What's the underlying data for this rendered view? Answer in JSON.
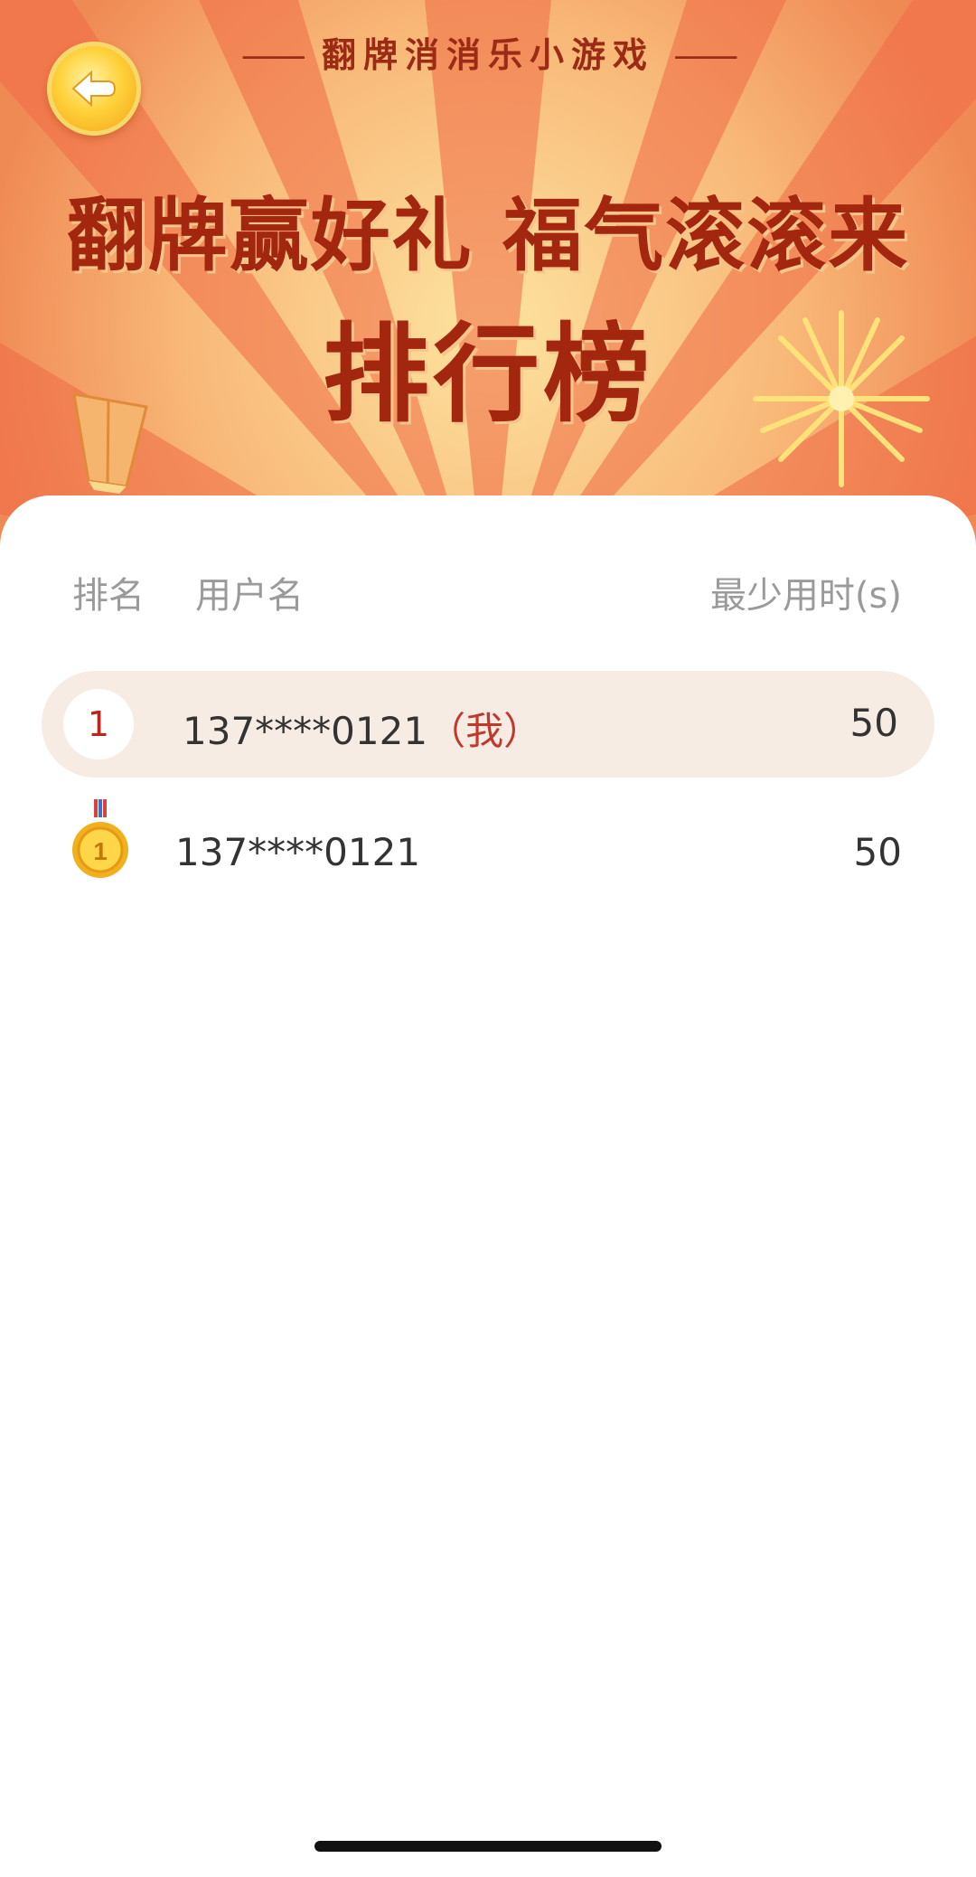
{
  "header": {
    "subtitle": "翻牌消消乐小游戏",
    "subtitle_dash": "——",
    "headline": "翻牌赢好礼 福气滚滚来",
    "board_title": "排行榜",
    "back_icon": "back-arrow-icon"
  },
  "table": {
    "columns": {
      "rank": "排名",
      "user": "用户名",
      "time": "最少用时(s)"
    },
    "my_row": {
      "rank": "1",
      "user": "137****0121",
      "me_tag": "（我）",
      "time": "50"
    },
    "rows": [
      {
        "rank_icon": "gold-medal-icon",
        "user": "137****0121",
        "time": "50"
      }
    ]
  },
  "colors": {
    "banner_bg": "#f7a063",
    "title_red": "#a3260f",
    "me_row_bg": "#f7ece4",
    "accent_red": "#c0392b"
  }
}
